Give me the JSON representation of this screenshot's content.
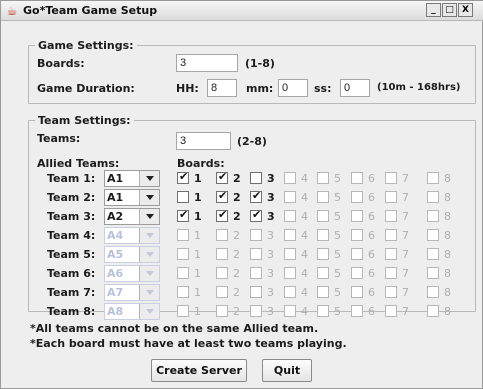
{
  "window": {
    "title": "Go*Team Game Setup",
    "icon": "java-cup-icon",
    "controls": {
      "minimize": "_",
      "maximize": "□",
      "close": "X"
    }
  },
  "game_settings": {
    "legend": "Game Settings:",
    "boards_label": "Boards:",
    "boards_value": "3",
    "boards_hint": "(1-8)",
    "duration_label": "Game Duration:",
    "hh_label": "HH:",
    "hh_value": "8",
    "mm_label": "mm:",
    "mm_value": "0",
    "ss_label": "ss:",
    "ss_value": "0",
    "duration_hint": "(10m - 168hrs)"
  },
  "team_settings": {
    "legend": "Team Settings:",
    "teams_label": "Teams:",
    "teams_value": "3",
    "teams_hint": "(2-8)",
    "allied_header": "Allied Teams:",
    "boards_header": "Boards:",
    "board_labels": [
      "1",
      "2",
      "3",
      "4",
      "5",
      "6",
      "7",
      "8"
    ],
    "rows": [
      {
        "label": "Team 1:",
        "allied": "A1",
        "enabled": true,
        "checked": [
          true,
          true,
          false,
          false,
          false,
          false,
          false,
          false
        ],
        "board_enabled": [
          true,
          true,
          true,
          false,
          false,
          false,
          false,
          false
        ]
      },
      {
        "label": "Team 2:",
        "allied": "A1",
        "enabled": true,
        "checked": [
          false,
          true,
          true,
          false,
          false,
          false,
          false,
          false
        ],
        "board_enabled": [
          true,
          true,
          true,
          false,
          false,
          false,
          false,
          false
        ]
      },
      {
        "label": "Team 3:",
        "allied": "A2",
        "enabled": true,
        "checked": [
          true,
          true,
          true,
          false,
          false,
          false,
          false,
          false
        ],
        "board_enabled": [
          true,
          true,
          true,
          false,
          false,
          false,
          false,
          false
        ]
      },
      {
        "label": "Team 4:",
        "allied": "A4",
        "enabled": false,
        "checked": [
          false,
          false,
          false,
          false,
          false,
          false,
          false,
          false
        ],
        "board_enabled": [
          false,
          false,
          false,
          false,
          false,
          false,
          false,
          false
        ]
      },
      {
        "label": "Team 5:",
        "allied": "A5",
        "enabled": false,
        "checked": [
          false,
          false,
          false,
          false,
          false,
          false,
          false,
          false
        ],
        "board_enabled": [
          false,
          false,
          false,
          false,
          false,
          false,
          false,
          false
        ]
      },
      {
        "label": "Team 6:",
        "allied": "A6",
        "enabled": false,
        "checked": [
          false,
          false,
          false,
          false,
          false,
          false,
          false,
          false
        ],
        "board_enabled": [
          false,
          false,
          false,
          false,
          false,
          false,
          false,
          false
        ]
      },
      {
        "label": "Team 7:",
        "allied": "A7",
        "enabled": false,
        "checked": [
          false,
          false,
          false,
          false,
          false,
          false,
          false,
          false
        ],
        "board_enabled": [
          false,
          false,
          false,
          false,
          false,
          false,
          false,
          false
        ]
      },
      {
        "label": "Team 8:",
        "allied": "A8",
        "enabled": false,
        "checked": [
          false,
          false,
          false,
          false,
          false,
          false,
          false,
          false
        ],
        "board_enabled": [
          false,
          false,
          false,
          false,
          false,
          false,
          false,
          false
        ]
      }
    ]
  },
  "notes": [
    "*All teams cannot be on the same Allied team.",
    "*Each board must have at least two teams playing."
  ],
  "buttons": {
    "create_server": "Create Server",
    "quit": "Quit"
  },
  "colors": {
    "window_bg": "#eeeeee",
    "disabled_text": "#b7c1dd"
  }
}
